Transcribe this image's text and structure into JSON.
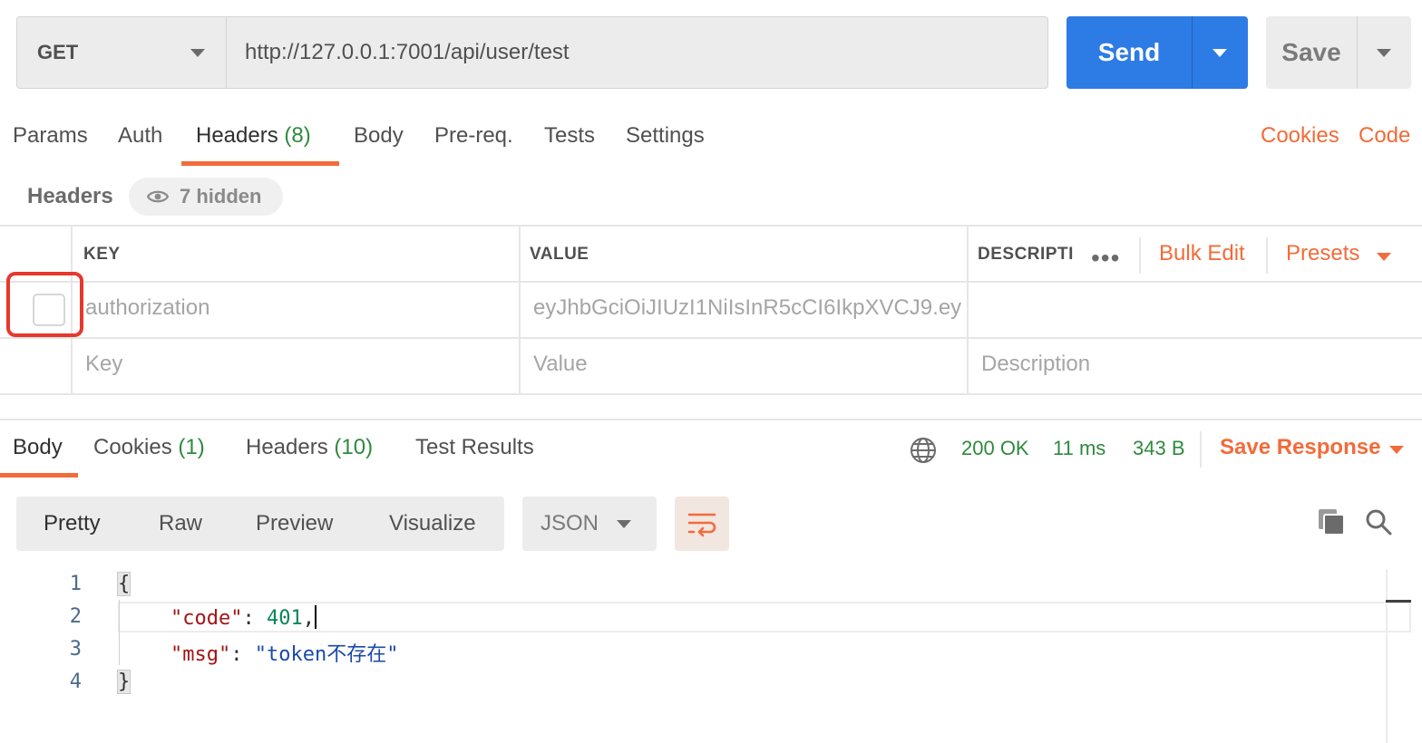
{
  "request": {
    "method": "GET",
    "url": "http://127.0.0.1:7001/api/user/test",
    "send_label": "Send",
    "save_label": "Save"
  },
  "request_tabs": {
    "params": "Params",
    "auth": "Auth",
    "headers": "Headers",
    "headers_count": "(8)",
    "body": "Body",
    "prereq": "Pre-req.",
    "tests": "Tests",
    "settings": "Settings",
    "cookies": "Cookies",
    "code": "Code"
  },
  "headers_section": {
    "title": "Headers",
    "hidden": "7 hidden",
    "columns": {
      "key": "KEY",
      "value": "VALUE",
      "description": "DESCRIPTI"
    },
    "more": "•••",
    "bulk_edit": "Bulk Edit",
    "presets": "Presets",
    "rows": [
      {
        "key": "authorization",
        "value": "eyJhbGciOiJIUzI1NiIsInR5cCI6IkpXVCJ9.ey...",
        "description": "",
        "checked": false
      }
    ],
    "placeholders": {
      "key": "Key",
      "value": "Value",
      "description": "Description"
    }
  },
  "response_tabs": {
    "body": "Body",
    "cookies": "Cookies",
    "cookies_count": "(1)",
    "headers": "Headers",
    "headers_count": "(10)",
    "test_results": "Test Results"
  },
  "response_status": {
    "status": "200 OK",
    "time": "11 ms",
    "size": "343 B",
    "save_response": "Save Response"
  },
  "view": {
    "pretty": "Pretty",
    "raw": "Raw",
    "preview": "Preview",
    "visualize": "Visualize",
    "format": "JSON"
  },
  "code": {
    "line_numbers": [
      "1",
      "2",
      "3",
      "4"
    ],
    "open_brace": "{",
    "close_brace": "}",
    "code_key": "\"code\"",
    "code_value": "401",
    "msg_key": "\"msg\"",
    "msg_value": "\"token不存在\""
  },
  "colors": {
    "accent_orange": "#f26b3a",
    "send_blue": "#2d7be5",
    "status_green": "#2f8a3c",
    "highlight_red": "#e8372c"
  }
}
